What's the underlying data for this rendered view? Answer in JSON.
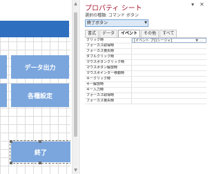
{
  "form": {
    "buttons": [
      {
        "label": "データ出力"
      },
      {
        "label": "各種設定"
      },
      {
        "label": "終了"
      }
    ]
  },
  "property_sheet": {
    "title": "プロパティ シート",
    "selection_label": "選択の種類: コマンド ボタン",
    "selected_control": "終了ボタン",
    "tabs": [
      "書式",
      "データ",
      "イベント",
      "その他",
      "すべて"
    ],
    "active_tab": "イベント",
    "rows": [
      {
        "name": "クリック時",
        "value": "[イベント プロシージャ]"
      },
      {
        "name": "フォーカス取得時",
        "value": ""
      },
      {
        "name": "フォーカス喪失時",
        "value": ""
      },
      {
        "name": "ダブルクリック時",
        "value": ""
      },
      {
        "name": "マウスボタンクリック時",
        "value": ""
      },
      {
        "name": "マウスボタン解放時",
        "value": ""
      },
      {
        "name": "マウスポインター移動時",
        "value": ""
      },
      {
        "name": "キークリック時",
        "value": ""
      },
      {
        "name": "キー解放時",
        "value": ""
      },
      {
        "name": "キー入力時",
        "value": ""
      },
      {
        "name": "フォーカス取得時",
        "value": ""
      },
      {
        "name": "フォーカス喪失時",
        "value": ""
      }
    ]
  },
  "icons": {
    "close": "close-icon",
    "dropdown": "chevron-down-icon",
    "scroll_up": "arrow-up-icon",
    "scroll_down": "arrow-down-icon"
  },
  "colors": {
    "section_bar": "#2f6fbf",
    "button": "#7ba6dd",
    "title": "#a6192e"
  }
}
